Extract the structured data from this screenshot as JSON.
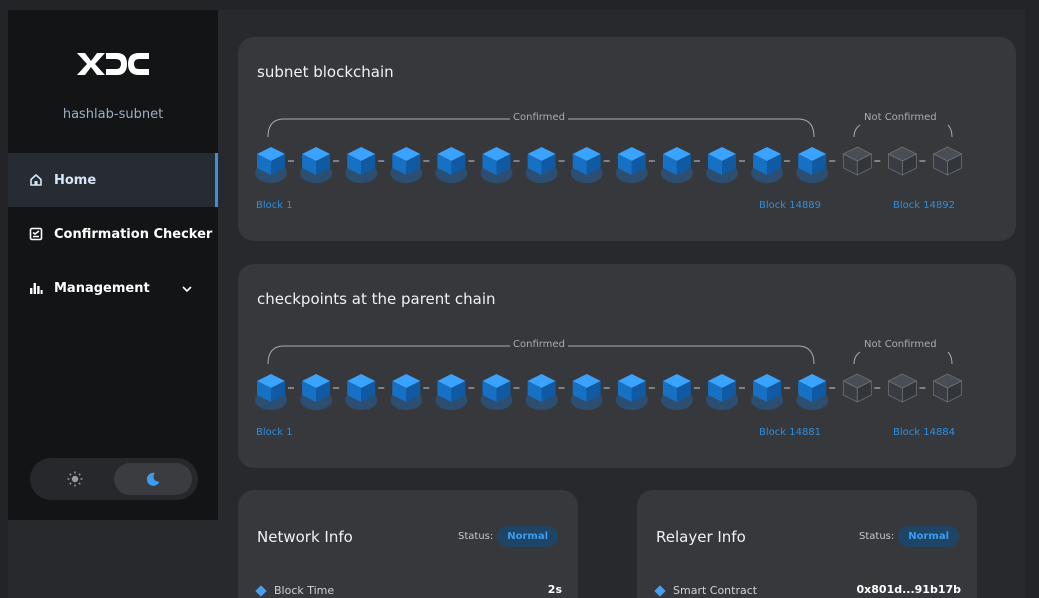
{
  "app": {
    "logo_text": "XDC",
    "subnet_name": "hashlab-subnet"
  },
  "sidebar": {
    "items": [
      {
        "label": "Home",
        "icon": "home-icon",
        "active": true
      },
      {
        "label": "Confirmation Checker",
        "icon": "checklist-icon",
        "active": false
      },
      {
        "label": "Management",
        "icon": "bar-chart-icon",
        "active": false,
        "expandable": true
      }
    ],
    "theme_toggle": {
      "options": [
        "light",
        "dark"
      ],
      "selected": "dark"
    }
  },
  "subnet_chain": {
    "title": "subnet blockchain",
    "confirmed_label": "Confirmed",
    "not_confirmed_label": "Not Confirmed",
    "confirmed_blocks": 13,
    "unconfirmed_blocks": 3,
    "first_block": "Block 1",
    "last_confirmed_block": "Block 14889",
    "latest_block": "Block 14892"
  },
  "parent_chain": {
    "title": "checkpoints at the parent chain",
    "confirmed_label": "Confirmed",
    "not_confirmed_label": "Not Confirmed",
    "confirmed_blocks": 13,
    "unconfirmed_blocks": 3,
    "first_block": "Block 1",
    "last_confirmed_block": "Block 14881",
    "latest_block": "Block 14884"
  },
  "network_info": {
    "title": "Network Info",
    "status_label": "Status:",
    "status_value": "Normal",
    "rows": [
      {
        "label": "Block Time",
        "value": "2s"
      }
    ]
  },
  "relayer_info": {
    "title": "Relayer Info",
    "status_label": "Status:",
    "status_value": "Normal",
    "rows": [
      {
        "label": "Smart Contract",
        "value": "0x801d...91b17b"
      }
    ]
  },
  "colors": {
    "accent": "#2c8fe0",
    "confirmed_block": "#1b78d0",
    "unconfirmed_block": "#4a5058",
    "sidebar_bg": "#131415",
    "card_bg": "#37383c"
  }
}
